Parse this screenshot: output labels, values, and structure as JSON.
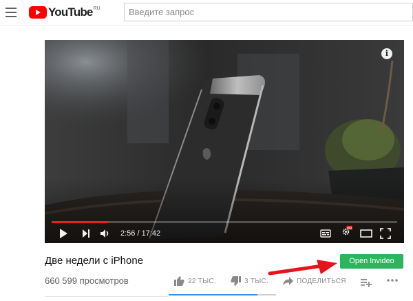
{
  "header": {
    "logo_text": "YouTube",
    "logo_region": "RU",
    "search_placeholder": "Введите запрос"
  },
  "player": {
    "current_time": "2:56",
    "duration": "17:42",
    "time_separator": " / ",
    "progress_played": 0.166,
    "progress_loaded": 0.166,
    "info_glyph": "i",
    "hd_badge": "HD",
    "icons": [
      "play-icon",
      "next-icon",
      "volume-icon",
      "subtitles-icon",
      "settings-icon",
      "theater-mode-icon",
      "fullscreen-icon"
    ]
  },
  "video": {
    "title": "Две недели с iPhone",
    "views": "660 599 просмотров",
    "likes": "22 ТЫС.",
    "dislikes": "3 ТЫС.",
    "share_label": "ПОДЕЛИТЬСЯ",
    "likes_ratio": 0.83
  },
  "extension": {
    "open_button_label": "Open Invideo",
    "button_color": "#2bb55d",
    "arrow_color": "#e8131a"
  },
  "colors": {
    "brand_red": "#ff0000",
    "progress_red": "#e52222",
    "sentiment_blue": "#3a8ee6"
  }
}
